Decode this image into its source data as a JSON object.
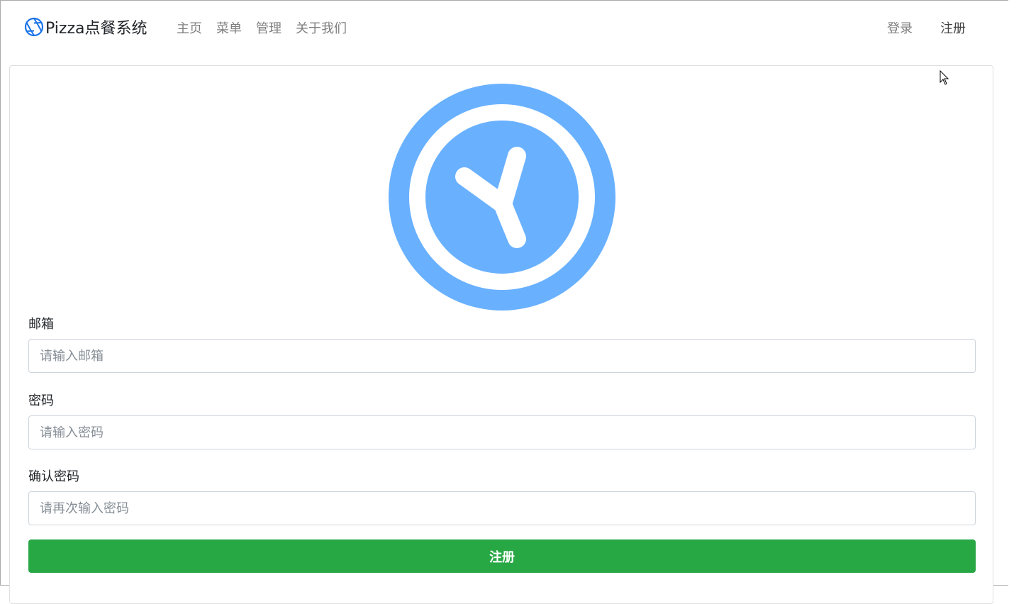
{
  "navbar": {
    "brand": "Pizza点餐系统",
    "brand_icon": "aperture-icon",
    "links": [
      "主页",
      "菜单",
      "管理",
      "关于我们"
    ],
    "right_links": [
      "登录",
      "注册"
    ]
  },
  "logo": {
    "icon": "clock-icon",
    "color": "#69b1ff"
  },
  "form": {
    "email_label": "邮箱",
    "email_placeholder": "请输入邮箱",
    "password_label": "密码",
    "password_placeholder": "请输入密码",
    "confirm_label": "确认密码",
    "confirm_placeholder": "请再次输入密码",
    "submit_label": "注册"
  },
  "colors": {
    "brand_blue": "#1a73e8",
    "submit_green": "#28a745"
  }
}
